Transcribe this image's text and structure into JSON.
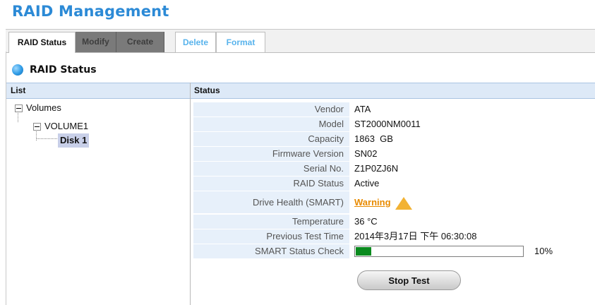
{
  "page": {
    "title": "RAID Management"
  },
  "tabs": [
    {
      "label": "RAID Status",
      "state": "active"
    },
    {
      "label": "Modify",
      "state": "disabled"
    },
    {
      "label": "Create",
      "state": "disabled"
    },
    {
      "label": "Delete",
      "state": "enabled"
    },
    {
      "label": "Format",
      "state": "enabled"
    }
  ],
  "section": {
    "title": "RAID Status",
    "icon": "blue-bullet-icon"
  },
  "table": {
    "headers": {
      "list": "List",
      "status": "Status"
    }
  },
  "tree": {
    "root": "Volumes",
    "volume": "VOLUME1",
    "disk": "Disk 1"
  },
  "status": {
    "vendor": {
      "label": "Vendor",
      "value": "ATA"
    },
    "model": {
      "label": "Model",
      "value": "ST2000NM0011"
    },
    "capacity": {
      "label": "Capacity",
      "value": "1863  GB"
    },
    "firmware": {
      "label": "Firmware Version",
      "value": "SN02"
    },
    "serial": {
      "label": "Serial No.",
      "value": "Z1P0ZJ6N"
    },
    "raid_status": {
      "label": "RAID Status",
      "value": "Active"
    },
    "drive_health": {
      "label": "Drive Health (SMART)",
      "value": "Warning",
      "icon": "warning-triangle-icon",
      "color": "#e88b00"
    },
    "temperature": {
      "label": "Temperature",
      "value": "36 °C"
    },
    "prev_test": {
      "label": "Previous Test Time",
      "value": "2014年3月17日 下午 06:30:08"
    },
    "smart_check": {
      "label": "SMART Status Check",
      "progress": 0.1,
      "percent_text": "10%",
      "bar_color": "#0a8a1e"
    }
  },
  "buttons": {
    "stop_test": "Stop Test"
  },
  "colors": {
    "accent": "#2c8ad6",
    "header_bg": "#dde9f7",
    "label_bg": "#e7f0fa"
  }
}
